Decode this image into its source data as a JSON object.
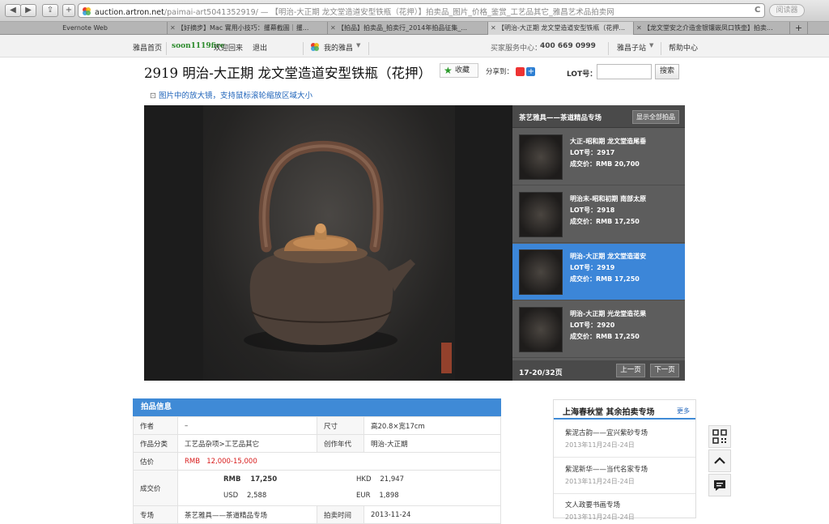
{
  "browser": {
    "back": "◀",
    "forward": "▶",
    "share": "⇪",
    "new_tab": "+",
    "url_host": "auction.artron.net",
    "url_rest": "/paimai-art5041352919/ — 【明治-大正期 龙文堂造道安型铁瓶（花押）】拍卖品_图片_价格_鉴赏_工艺品其它_雅昌艺术品拍卖网",
    "reload": "C",
    "reader_label": "阅读器",
    "tabs": [
      {
        "label": "Evernote Web"
      },
      {
        "label": "【好摘步】Mac 實用小技巧：攫幕截圖｜攫..."
      },
      {
        "label": "【拍品】拍卖品_拍卖行_2014年拍品征集_..."
      },
      {
        "label": "【明治-大正期 龙文堂造道安型铁瓶（花押..."
      },
      {
        "label": "【龙文堂安之介造金银镶嵌凤口铁壶】拍卖..."
      }
    ]
  },
  "topnav": {
    "home": "雅昌首页",
    "username": "soon1119fire",
    "welcome": "欢迎回来",
    "logout": "退出",
    "my_yachang": "我的雅昌",
    "service_label": "买家服务中心：",
    "service_phone": "400 669 0999",
    "substations": "雅昌子站",
    "help": "帮助中心"
  },
  "lot": {
    "title": "2919 明治-大正期 龙文堂造道安型铁瓶（花押）",
    "favorite": "收藏",
    "share_label": "分享到：",
    "lot_label": "LOT号：",
    "lot_input": "",
    "search": "搜索",
    "zoom_hint": "图片中的放大镜，支持鼠标滚轮缩放区域大小"
  },
  "panel": {
    "title": "茶艺雅具——茶道精品专场",
    "show_all": "显示全部拍品",
    "items": [
      {
        "name": "大正-昭和期 龙文堂造尾垂",
        "lot": "LOT号：2917",
        "price": "成交价：RMB 20,700"
      },
      {
        "name": "明治末-昭和初期 南部太原",
        "lot": "LOT号：2918",
        "price": "成交价：RMB 17,250"
      },
      {
        "name": "明治-大正期 龙文堂造道安",
        "lot": "LOT号：2919",
        "price": "成交价：RMB 17,250"
      },
      {
        "name": "明治-大正期 光龙堂造花果",
        "lot": "LOT号：2920",
        "price": "成交价：RMB 17,250"
      }
    ],
    "page_count": "17-20/32页",
    "prev": "上一页",
    "next": "下一页"
  },
  "info": {
    "header": "拍品信息",
    "author_k": "作者",
    "author_v": "–",
    "size_k": "尺寸",
    "size_v": "高20.8×宽17cm",
    "category_k": "作品分类",
    "category_v": "工艺品杂项>工艺品其它",
    "era_k": "创作年代",
    "era_v": "明治-大正期",
    "estimate_k": "估价",
    "estimate_cur": "RMB",
    "estimate_v": "12,000-15,000",
    "deal_k": "成交价",
    "rmb_cur": "RMB",
    "rmb_v": "17,250",
    "hkd_cur": "HKD",
    "hkd_v": "21,947",
    "usd_cur": "USD",
    "usd_v": "2,588",
    "eur_cur": "EUR",
    "eur_v": "1,898",
    "session_k": "专场",
    "session_v": "茶艺雅具——茶道精品专场",
    "time_k": "拍卖时间",
    "time_v": "2013-11-24"
  },
  "side": {
    "title": "上海春秋堂 其余拍卖专场",
    "more": "更多",
    "items": [
      {
        "name": "紫泥古韵——宜兴紫砂专场",
        "date": "2013年11月24日-24日"
      },
      {
        "name": "紫泥新华——当代名家专场",
        "date": "2013年11月24日-24日"
      },
      {
        "name": "文人政要书画专场",
        "date": "2013年11月24日-24日"
      }
    ]
  },
  "colors": {
    "accent": "#3f8ad6",
    "price_red": "#d81b1b"
  },
  "icons": [
    "qr-code-icon",
    "back-to-top-icon",
    "feedback-icon"
  ]
}
